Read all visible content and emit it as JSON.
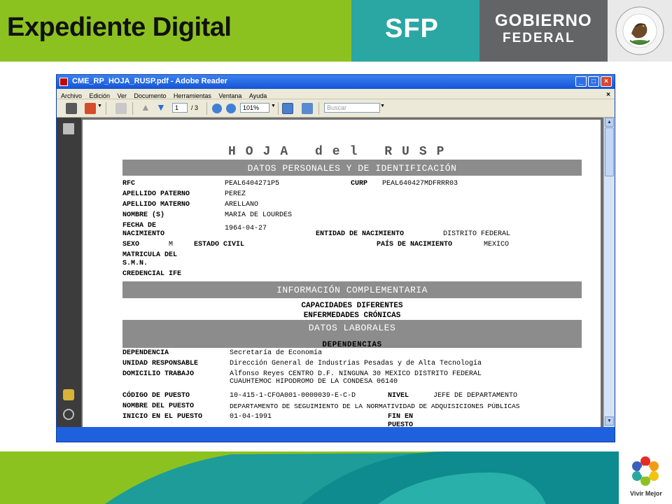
{
  "slide": {
    "title": "Expediente Digital",
    "agency": "SFP",
    "gov_line1": "GOBIERNO",
    "gov_line2": "FEDERAL",
    "seal_text": "ESTADOS UNIDOS MEXICANOS",
    "footer_logo_text": "Vivir Mejor",
    "colors": {
      "green": "#8cc21f",
      "teal": "#2aa6a3",
      "gray": "#636466"
    }
  },
  "window": {
    "title": "CME_RP_HOJA_RUSP.pdf - Adobe Reader",
    "menu": [
      "Archivo",
      "Edición",
      "Ver",
      "Documento",
      "Herramientas",
      "Ventana",
      "Ayuda"
    ],
    "page_current": "1",
    "page_total": "/ 3",
    "zoom": "101%",
    "search_placeholder": "Buscar"
  },
  "document": {
    "title": "HOJA del RUSP",
    "section_personal": "DATOS PERSONALES Y DE IDENTIFICACIÓN",
    "rfc_label": "RFC",
    "rfc": "PEAL6404271P5",
    "curp_label": "CURP",
    "curp": "PEAL640427MDFRRR03",
    "apellido_paterno_label": "APELLIDO PATERNO",
    "apellido_paterno": "PEREZ",
    "apellido_materno_label": "APELLIDO MATERNO",
    "apellido_materno": "ARELLANO",
    "nombre_label": "NOMBRE (S)",
    "nombre": "MARIA DE LOURDES",
    "fecha_label_1": "FECHA DE",
    "fecha_label_2": "NACIMIENTO",
    "fecha": "1964-04-27",
    "entidad_label": "ENTIDAD DE NACIMIENTO",
    "entidad": "DISTRITO FEDERAL",
    "sexo_label": "SEXO",
    "sexo": "M",
    "estado_civil_label": "ESTADO CIVIL",
    "pais_label": "PAÍS DE NACIMIENTO",
    "pais": "MEXICO",
    "matricula_label_1": "MATRICULA DEL",
    "matricula_label_2": "S.M.N.",
    "credencial_label": "CREDENCIAL IFE",
    "section_complementaria": "INFORMACIÓN COMPLEMENTARIA",
    "capacidades": "CAPACIDADES DIFERENTES",
    "enfermedades": "ENFERMEDADES CRÓNICAS",
    "section_laborales": "DATOS LABORALES",
    "dependencias_heading": "DEPENDENCIAS",
    "dependencia_label": "DEPENDENCIA",
    "dependencia": "Secretaría de Economía",
    "unidad_label": "UNIDAD RESPONSABLE",
    "unidad": "Dirección General de Industrias Pesadas y de Alta Tecnología",
    "domicilio_label": "DOMICILIO TRABAJO",
    "domicilio_1": "Alfonso Reyes CENTRO D.F. NINGUNA 30 MEXICO DISTRITO FEDERAL",
    "domicilio_2": "CUAUHTEMOC HIPODROMO DE LA CONDESA 06140",
    "codigo_label": "CÓDIGO DE PUESTO",
    "codigo": "10-415-1-CFOA001-0000039-E-C-D",
    "nivel_label": "NIVEL",
    "nivel": "JEFE DE DEPARTAMENTO",
    "nombre_puesto_label": "NOMBRE DEL PUESTO",
    "nombre_puesto": "DEPARTAMENTO DE SEGUIMIENTO DE LA NORMATIVIDAD DE ADQUISICIONES PÚBLICAS",
    "inicio_label": "INICIO EN EL PUESTO",
    "inicio": "01-04-1991",
    "fin_label_1": "FIN EN",
    "fin_label_2": "PUESTO"
  }
}
